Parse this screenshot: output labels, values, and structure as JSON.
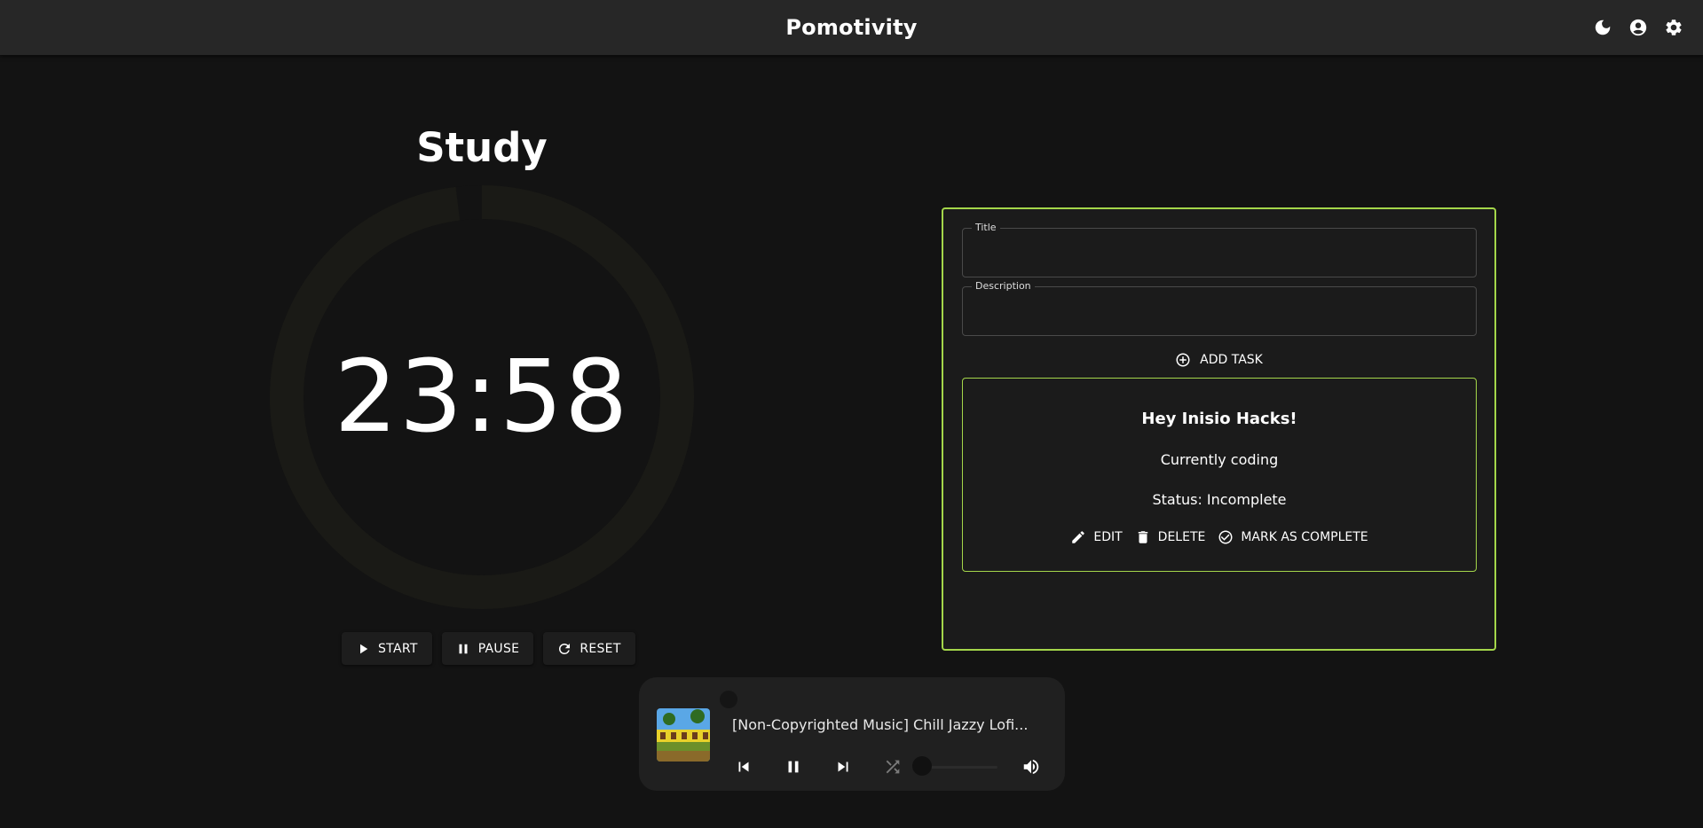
{
  "app": {
    "title": "Pomotivity",
    "header_icons": [
      "moon-icon",
      "account-icon",
      "gear-icon"
    ]
  },
  "timer": {
    "mode": "Study",
    "time": "23:58",
    "progress_remaining": 0.98,
    "controls": {
      "start": "START",
      "pause": "PAUSE",
      "reset": "RESET"
    }
  },
  "tasks": {
    "title_label": "Title",
    "title_value": "",
    "description_label": "Description",
    "description_value": "",
    "add_task_label": "ADD TASK",
    "items": [
      {
        "title": "Hey Inisio Hacks!",
        "description": "Currently coding",
        "status": "Status: Incomplete",
        "edit_label": "EDIT",
        "delete_label": "DELETE",
        "complete_label": "MARK AS COMPLETE"
      }
    ]
  },
  "player": {
    "track_title": "[Non-Copyrighted Music] Chill Jazzy Lofi...",
    "playback_progress": 0.0,
    "volume": 0.0,
    "controls": [
      "skip-previous-icon",
      "pause-icon",
      "skip-next-icon",
      "shuffle-icon",
      "volume-icon"
    ]
  },
  "colors": {
    "background": "#131313",
    "appbar": "#272727",
    "accent": "#a4d64a",
    "panel": "#1b1b1b",
    "ring": "#1a1a16"
  }
}
